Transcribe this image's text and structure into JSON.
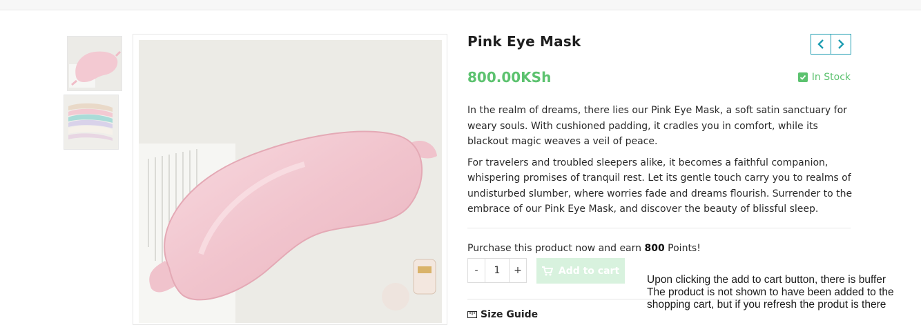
{
  "product": {
    "title": "Pink Eye Mask",
    "price": "800.00KSh",
    "stock_status": "In Stock",
    "description": [
      "In the realm of dreams, there lies our Pink Eye Mask, a soft satin sanctuary for weary souls. With cushioned padding, it cradles you in comfort, while its blackout magic weaves a veil of peace.",
      "For travelers and troubled sleepers alike, it becomes a faithful companion, whispering promises of tranquil rest. Let its gentle touch carry you to realms of undisturbed slumber, where worries fade and dreams flourish. Surrender to the embrace of our Pink Eye Mask, and discover the beauty of blissful sleep."
    ],
    "points_prefix": "Purchase this product now and earn ",
    "points_value": "800",
    "points_suffix": " Points!",
    "quantity": "1",
    "minus_label": "-",
    "plus_label": "+",
    "add_to_cart_label": "Add to cart",
    "size_guide_label": "Size Guide"
  },
  "annotation": {
    "lines": [
      "Upon clicking the add to cart button, there is buffer",
      "The product is not shown to have been added to the",
      "shopping cart, but if you refresh the produt is there"
    ]
  },
  "icons": {
    "prev": "chevron-left-icon",
    "next": "chevron-right-icon",
    "stock": "checkbox-checked-icon",
    "cart": "shopping-cart-icon",
    "size_guide": "ruler-icon"
  },
  "colors": {
    "accent": "#1a9bb0",
    "price_green": "#5cc26f",
    "add_to_cart_bg": "#d8f2de",
    "mask_pink": "#f3c9d2"
  }
}
